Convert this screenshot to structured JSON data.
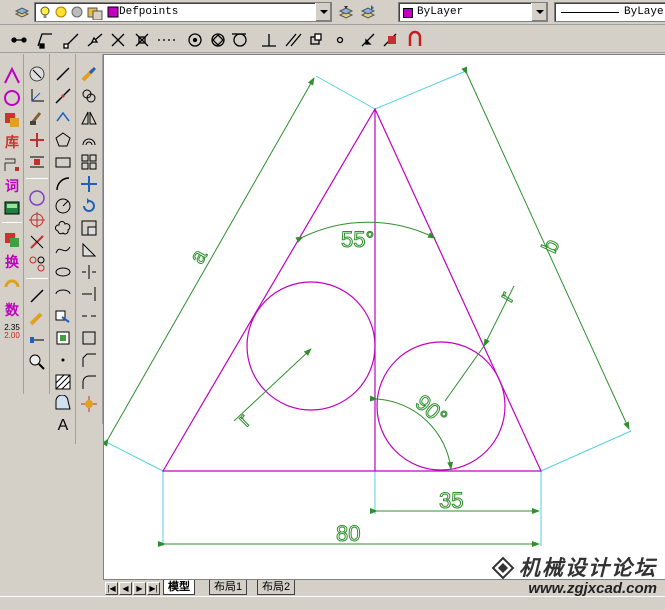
{
  "layer_toolbar": {
    "layer_name": "Defpoints",
    "color_name": "ByLayer",
    "linetype_name": "ByLayer"
  },
  "colors": {
    "layer_swatch": "#c000c0",
    "geometry": "#c000c0",
    "dimension_green": "#2f8f2f",
    "extension_cyan": "#55d0e0",
    "canvas_bg": "#ffffff"
  },
  "palette_icons": [
    "line-icon",
    "circle-icon",
    "insert-block-icon",
    "library-icon",
    "dimension-icon",
    "vocabulary-icon",
    "calculator-icon",
    "block-attribute-icon",
    "convert-icon",
    "rotate-icon",
    "number-icon",
    "decimal-icon"
  ],
  "palette_labels": {
    "library": "库",
    "vocab": "词",
    "convert": "换",
    "number": "数",
    "decimal_top": "2.35",
    "decimal_bottom": "2.00",
    "text_tool": "A"
  },
  "drawing": {
    "dim_a": "a",
    "dim_b": "b",
    "angle_top": "55°",
    "angle_bottom": "90°",
    "dim_35": "35",
    "dim_80": "80",
    "radius_left": "r",
    "radius_right": "r"
  },
  "tabs": {
    "model": "模型",
    "layout1": "布局1",
    "layout2": "布局2"
  },
  "watermark": {
    "title": "机械设计论坛",
    "url": "www.zgjxcad.com"
  }
}
